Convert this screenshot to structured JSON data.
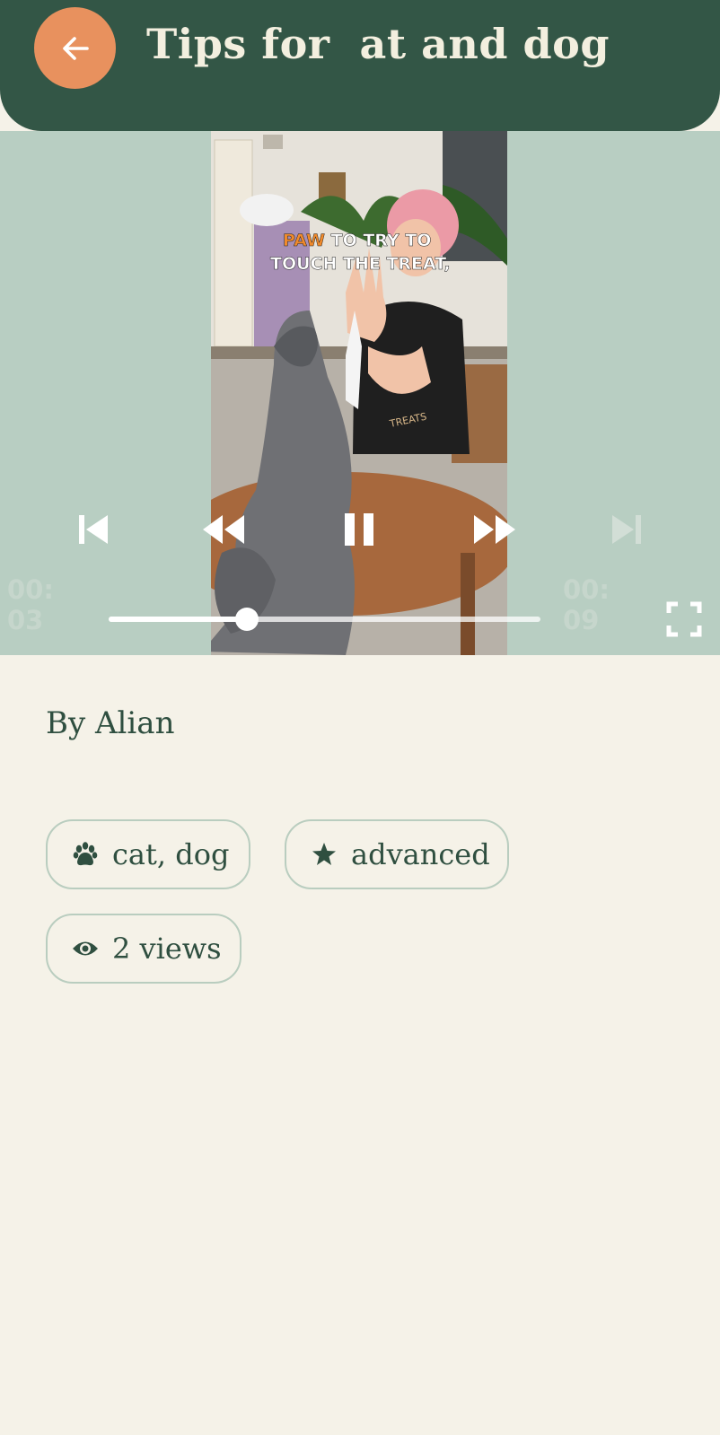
{
  "header": {
    "title": "Tips for  at and dog"
  },
  "video": {
    "caption_highlight": "PAW",
    "caption_line1": " TO TRY TO",
    "caption_line2": "TOUCH THE TREAT,",
    "shirt_text": "TREATS",
    "current_time": "00:03",
    "total_time": "00:09",
    "progress": 0.32
  },
  "details": {
    "author": "By Alian",
    "chips": [
      {
        "label": "cat, dog",
        "icon": "paw-icon"
      },
      {
        "label": "advanced",
        "icon": "star-icon"
      },
      {
        "label": "2 views",
        "icon": "eye-icon"
      }
    ]
  },
  "colors": {
    "header_bg": "#335646",
    "accent": "#e8915e",
    "page_bg": "#f5f2e8",
    "player_bg": "#b8cec2"
  }
}
